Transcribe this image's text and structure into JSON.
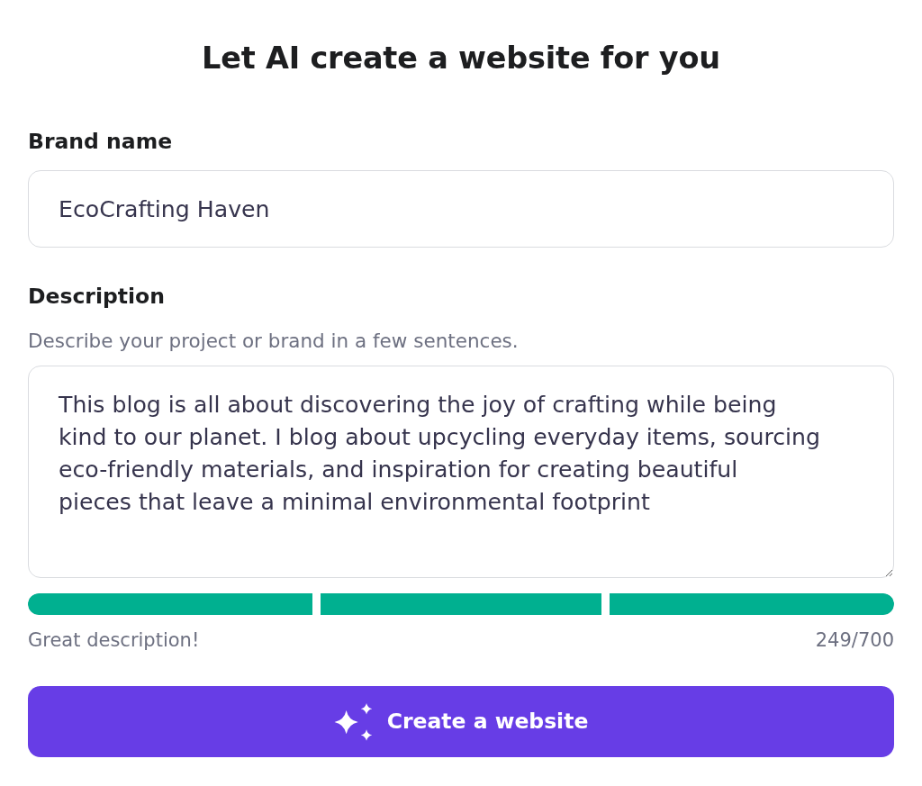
{
  "title": "Let AI create a website for you",
  "fields": [
    {
      "kind": "input",
      "label": "Brand name",
      "value": "EcoCrafting Haven"
    },
    {
      "kind": "textarea",
      "label": "Description",
      "hint": "Describe your project or brand in a few sentences.",
      "value": "This blog is all about discovering the joy of crafting while being\nkind to our planet. I blog about upcycling everyday items, sourcing\neco-friendly materials, and inspiration for creating beautiful\npieces that leave a minimal environmental footprint",
      "meter": {
        "level": 1,
        "feedback": "Great description!",
        "counter": "249/700"
      }
    }
  ],
  "button": {
    "label": "Create a website"
  }
}
